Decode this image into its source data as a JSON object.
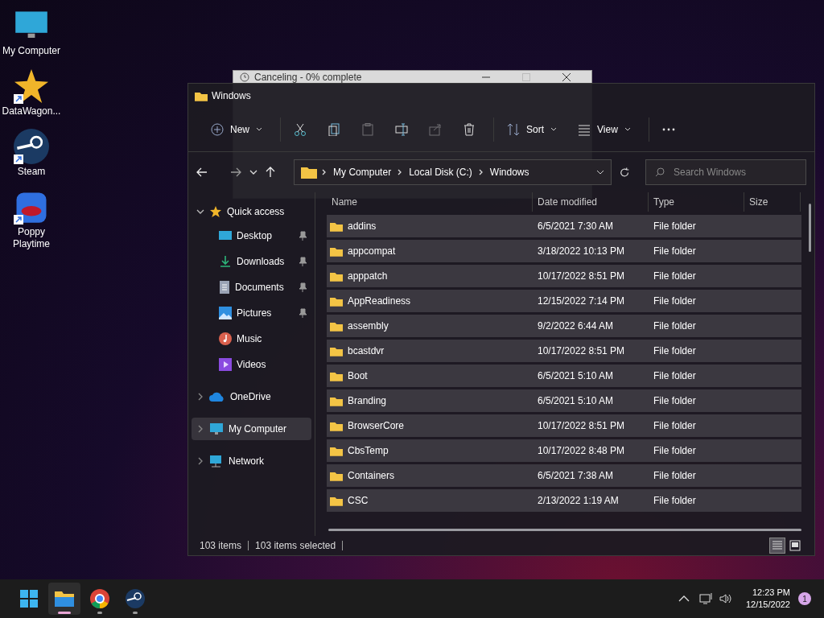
{
  "desktop_icons": [
    {
      "label": "My Computer",
      "kind": "computer",
      "shortcut": false
    },
    {
      "label": "DataWagon...",
      "kind": "star",
      "shortcut": true
    },
    {
      "label": "Steam",
      "kind": "steam",
      "shortcut": true
    },
    {
      "label": "Poppy Playtime",
      "kind": "game",
      "shortcut": true
    }
  ],
  "background_dialog": {
    "title": "Canceling - 0% complete"
  },
  "window": {
    "title": "Windows",
    "toolbar": [
      {
        "kind": "new",
        "label": "New",
        "disabled": false
      },
      {
        "kind": "cut",
        "disabled": false
      },
      {
        "kind": "copy",
        "disabled": false
      },
      {
        "kind": "paste",
        "disabled": true
      },
      {
        "kind": "rename",
        "disabled": false
      },
      {
        "kind": "share",
        "disabled": true
      },
      {
        "kind": "delete",
        "disabled": false
      },
      {
        "kind": "sort",
        "label": "Sort",
        "disabled": false
      },
      {
        "kind": "view",
        "label": "View",
        "disabled": false
      },
      {
        "kind": "more",
        "disabled": false
      }
    ],
    "breadcrumb": [
      "My Computer",
      "Local Disk (C:)",
      "Windows"
    ],
    "search": {
      "placeholder": "Search Windows"
    },
    "sidebar": [
      {
        "label": "Quick access",
        "kind": "star",
        "expanded": true,
        "selected": false,
        "children": [
          {
            "label": "Desktop",
            "kind": "desktop",
            "pinned": true,
            "selected": false
          },
          {
            "label": "Downloads",
            "kind": "downloads",
            "pinned": true,
            "selected": false
          },
          {
            "label": "Documents",
            "kind": "documents",
            "pinned": true,
            "selected": false
          },
          {
            "label": "Pictures",
            "kind": "pictures",
            "pinned": true,
            "selected": false
          },
          {
            "label": "Music",
            "kind": "music",
            "pinned": false,
            "selected": false
          },
          {
            "label": "Videos",
            "kind": "videos",
            "pinned": false,
            "selected": false
          }
        ]
      },
      {
        "label": "OneDrive",
        "kind": "cloud",
        "expanded": false,
        "selected": false
      },
      {
        "label": "My Computer",
        "kind": "computer",
        "expanded": false,
        "selected": true
      },
      {
        "label": "Network",
        "kind": "network",
        "expanded": false,
        "selected": false
      }
    ],
    "columns": [
      "Name",
      "Date modified",
      "Type",
      "Size"
    ],
    "rows": [
      {
        "name": "addins",
        "date": "6/5/2021 7:30 AM",
        "type": "File folder",
        "selected": true
      },
      {
        "name": "appcompat",
        "date": "3/18/2022 10:13 PM",
        "type": "File folder",
        "selected": true
      },
      {
        "name": "apppatch",
        "date": "10/17/2022 8:51 PM",
        "type": "File folder",
        "selected": true
      },
      {
        "name": "AppReadiness",
        "date": "12/15/2022 7:14 PM",
        "type": "File folder",
        "selected": true
      },
      {
        "name": "assembly",
        "date": "9/2/2022 6:44 AM",
        "type": "File folder",
        "selected": true
      },
      {
        "name": "bcastdvr",
        "date": "10/17/2022 8:51 PM",
        "type": "File folder",
        "selected": true
      },
      {
        "name": "Boot",
        "date": "6/5/2021 5:10 AM",
        "type": "File folder",
        "selected": true
      },
      {
        "name": "Branding",
        "date": "6/5/2021 5:10 AM",
        "type": "File folder",
        "selected": true
      },
      {
        "name": "BrowserCore",
        "date": "10/17/2022 8:51 PM",
        "type": "File folder",
        "selected": true
      },
      {
        "name": "CbsTemp",
        "date": "10/17/2022 8:48 PM",
        "type": "File folder",
        "selected": true
      },
      {
        "name": "Containers",
        "date": "6/5/2021 7:38 AM",
        "type": "File folder",
        "selected": true
      },
      {
        "name": "CSC",
        "date": "2/13/2022 1:19 AM",
        "type": "File folder",
        "selected": true
      }
    ],
    "status": {
      "count": "103 items",
      "selected": "103 items selected"
    },
    "view_modes": [
      {
        "kind": "details",
        "selected": true
      },
      {
        "kind": "tiles",
        "selected": false
      }
    ]
  },
  "taskbar": {
    "apps": [
      {
        "kind": "start",
        "running": false,
        "active": false
      },
      {
        "kind": "explorer",
        "running": true,
        "active": true
      },
      {
        "kind": "chrome",
        "running": true,
        "active": false
      },
      {
        "kind": "steam",
        "running": true,
        "active": false
      }
    ],
    "time": "12:23 PM",
    "date": "12/15/2022",
    "notifications": "1"
  }
}
